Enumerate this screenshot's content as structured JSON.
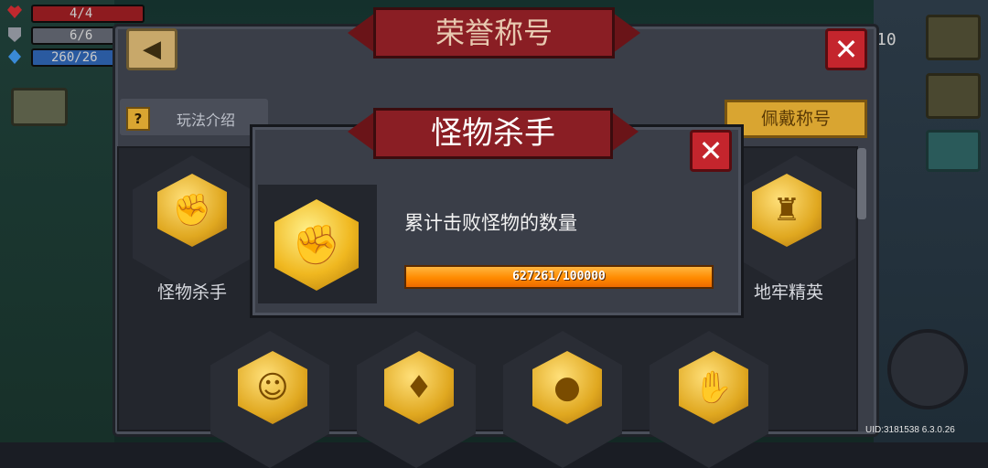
{
  "hud": {
    "hp": "4/4",
    "armor": "6/6",
    "energy": "260/26",
    "coins": "10"
  },
  "panel": {
    "title": "荣誉称号",
    "back_icon": "back-arrow-icon",
    "close_icon": "close-icon",
    "howto_label": "玩法介绍",
    "howto_icon": "?",
    "equip_label": "佩戴称号"
  },
  "badges": [
    {
      "label": "怪物杀手",
      "icon": "fist-badge-icon"
    },
    {
      "label": "地牢精英",
      "icon": "tower-badge-icon"
    },
    {
      "label": "",
      "icon": "smile-badge-icon"
    },
    {
      "label": "",
      "icon": "armor-badge-icon"
    },
    {
      "label": "",
      "icon": "broken-orb-badge-icon"
    },
    {
      "label": "",
      "icon": "gauntlet-badge-icon"
    }
  ],
  "modal": {
    "title": "怪物杀手",
    "description": "累计击败怪物的数量",
    "progress_text": "627261/100000",
    "progress_fraction": 1.0,
    "close_icon": "close-icon"
  },
  "footer": {
    "uid": "UID:3181538 6.3.0.26"
  },
  "colors": {
    "banner_red": "#8a1e24",
    "gold": "#d9a531",
    "close_red": "#c4252d",
    "progress_orange": "#ff8a00"
  }
}
